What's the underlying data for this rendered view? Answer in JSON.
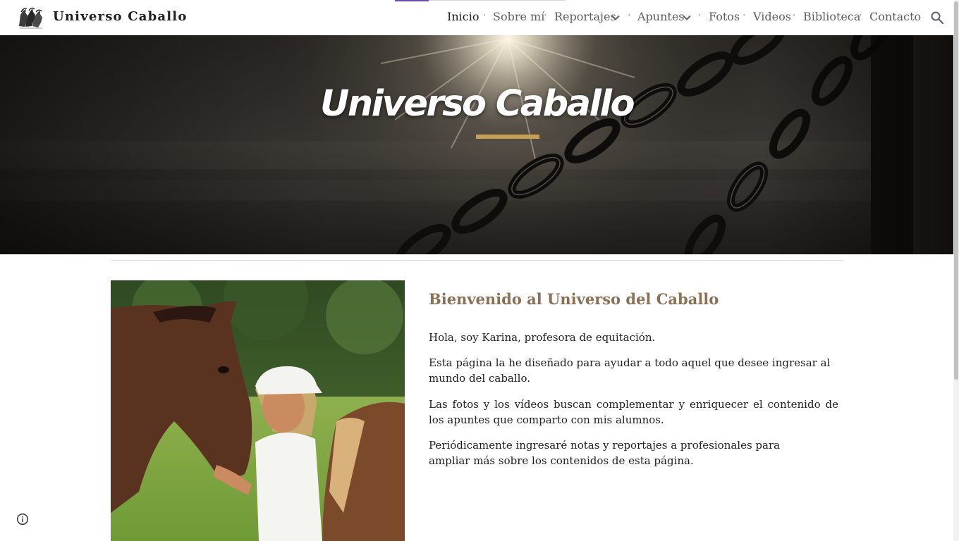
{
  "site": {
    "title": "Universo Caballo"
  },
  "nav": {
    "items": [
      {
        "label": "Inicio",
        "active": true,
        "dropdown": false
      },
      {
        "label": "Sobre mí",
        "active": false,
        "dropdown": false
      },
      {
        "label": "Reportajes",
        "active": false,
        "dropdown": true
      },
      {
        "label": "Apuntes",
        "active": false,
        "dropdown": true
      },
      {
        "label": "Fotos",
        "active": false,
        "dropdown": false
      },
      {
        "label": "Videos",
        "active": false,
        "dropdown": false
      },
      {
        "label": "Biblioteca",
        "active": false,
        "dropdown": false
      },
      {
        "label": "Contacto",
        "active": false,
        "dropdown": false
      }
    ],
    "separator": "·",
    "search_icon": "search-icon"
  },
  "hero": {
    "title": "Universo Caballo",
    "accent_color": "#c7a152"
  },
  "content": {
    "heading": "Bienvenido al Universo del Caballo",
    "heading_color": "#8a7155",
    "paragraphs": [
      "Hola, soy Karina, profesora de equitación.",
      "Esta página la he diseñado para ayudar a todo aquel que desee ingresar al mundo del caballo.",
      "Las fotos y los vídeos buscan complementar y enriquecer el contenido de los apuntes que comparto con mis alumnos.",
      "Periódicamente ingresaré notas y reportajes a profesionales para ampliar más sobre los  contenidos de esta página."
    ]
  },
  "footer": {
    "info_icon": "info-icon"
  },
  "colors": {
    "progress": "#6f4aa8",
    "active_nav": "#212121",
    "nav": "#5f5f5f"
  }
}
